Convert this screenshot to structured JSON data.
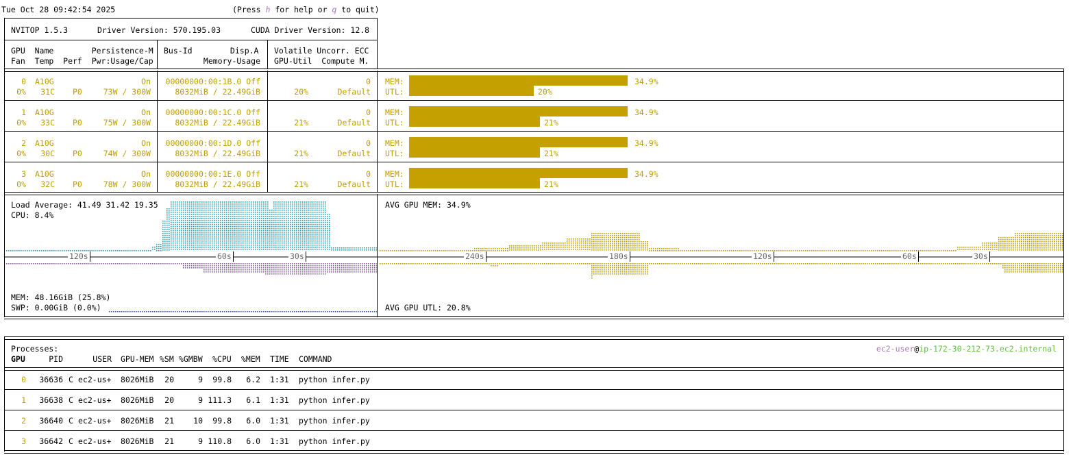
{
  "top": {
    "datetime": "Tue Oct 28 09:42:54 2025",
    "help_prefix": "(Press ",
    "help_key": "h",
    "help_mid": " for help or ",
    "quit_key": "q",
    "help_suffix": " to quit)"
  },
  "header": {
    "app": "NVITOP 1.5.3",
    "driver": "Driver Version: 570.195.03",
    "cuda": "CUDA Driver Version: 12.8",
    "col1_line1": "GPU  Name        Persistence-M",
    "col1_line2": "Fan  Temp  Perf  Pwr:Usage/Cap",
    "col2_line1": "Bus-Id        Disp.A",
    "col2_line2": "Memory-Usage",
    "col3_line1": "Volatile Uncorr. ECC",
    "col3_line2": "GPU-Util  Compute M."
  },
  "gpus": [
    {
      "idx": "0",
      "name": "A10G",
      "persist": "On",
      "fan": "0%",
      "temp": "31C",
      "perf": "P0",
      "pwr": "73W / 300W",
      "bus": "00000000:00:1B.0 Off",
      "mem": "8032MiB / 22.49GiB",
      "ecc": "0",
      "util": "20%",
      "compute": "Default",
      "mem_label": "MEM:",
      "mem_pct": "34.9%",
      "mem_frac": 0.349,
      "utl_label": "UTL:",
      "utl_pct": "20%",
      "utl_frac": 0.2
    },
    {
      "idx": "1",
      "name": "A10G",
      "persist": "On",
      "fan": "0%",
      "temp": "33C",
      "perf": "P0",
      "pwr": "75W / 300W",
      "bus": "00000000:00:1C.0 Off",
      "mem": "8032MiB / 22.49GiB",
      "ecc": "0",
      "util": "21%",
      "compute": "Default",
      "mem_label": "MEM:",
      "mem_pct": "34.9%",
      "mem_frac": 0.349,
      "utl_label": "UTL:",
      "utl_pct": "21%",
      "utl_frac": 0.21
    },
    {
      "idx": "2",
      "name": "A10G",
      "persist": "On",
      "fan": "0%",
      "temp": "30C",
      "perf": "P0",
      "pwr": "74W / 300W",
      "bus": "00000000:00:1D.0 Off",
      "mem": "8032MiB / 22.49GiB",
      "ecc": "0",
      "util": "21%",
      "compute": "Default",
      "mem_label": "MEM:",
      "mem_pct": "34.9%",
      "mem_frac": 0.349,
      "utl_label": "UTL:",
      "utl_pct": "21%",
      "utl_frac": 0.21
    },
    {
      "idx": "3",
      "name": "A10G",
      "persist": "On",
      "fan": "0%",
      "temp": "32C",
      "perf": "P0",
      "pwr": "78W / 300W",
      "bus": "00000000:00:1E.0 Off",
      "mem": "8032MiB / 22.49GiB",
      "ecc": "0",
      "util": "21%",
      "compute": "Default",
      "mem_label": "MEM:",
      "mem_pct": "34.9%",
      "mem_frac": 0.349,
      "utl_label": "UTL:",
      "utl_pct": "21%",
      "utl_frac": 0.21
    }
  ],
  "host_panel": {
    "load": "Load Average: 41.49 31.42 19.35",
    "cpu": "CPU: 8.4%",
    "mem": "MEM: 48.16GiB (25.8%)",
    "swp": "SWP: 0.00GiB (0.0%)",
    "ticks": [
      "120s",
      "60s",
      "30s"
    ]
  },
  "gpu_panel": {
    "avg_mem": "AVG GPU MEM: 34.9%",
    "avg_utl": "AVG GPU UTL: 20.8%",
    "ticks": [
      "240s",
      "180s",
      "120s",
      "60s",
      "30s"
    ]
  },
  "colors": {
    "gpu_yellow": "#bf9d00",
    "cpu_teal": "#26a0b5",
    "mem_purple": "#8e5fa3",
    "user_purple": "#a67ab1",
    "host_green": "#5fbf3a"
  },
  "processes": {
    "title": "Processes:",
    "user": "ec2-user",
    "at": "@",
    "host": "ip-172-30-212-73.ec2.internal",
    "columns": {
      "gpu": "GPU",
      "pid": "PID",
      "user": "USER",
      "gpumem": "GPU-MEM",
      "sm": "%SM",
      "gmbw": "%GMBW",
      "cpu": "%CPU",
      "mem": "%MEM",
      "time": "TIME",
      "cmd": "COMMAND"
    },
    "rows": [
      {
        "gpu": "0",
        "pid": "36636",
        "type": "C",
        "user": "ec2-us+",
        "gpumem": "8026MiB",
        "sm": "20",
        "gmbw": "9",
        "cpu": "99.8",
        "mem": "6.2",
        "time": "1:31",
        "cmd": "python infer.py"
      },
      {
        "gpu": "1",
        "pid": "36638",
        "type": "C",
        "user": "ec2-us+",
        "gpumem": "8026MiB",
        "sm": "20",
        "gmbw": "9",
        "cpu": "111.3",
        "mem": "6.1",
        "time": "1:31",
        "cmd": "python infer.py"
      },
      {
        "gpu": "2",
        "pid": "36640",
        "type": "C",
        "user": "ec2-us+",
        "gpumem": "8026MiB",
        "sm": "21",
        "gmbw": "10",
        "cpu": "99.8",
        "mem": "6.0",
        "time": "1:31",
        "cmd": "python infer.py"
      },
      {
        "gpu": "3",
        "pid": "36642",
        "type": "C",
        "user": "ec2-us+",
        "gpumem": "8026MiB",
        "sm": "21",
        "gmbw": "9",
        "cpu": "110.8",
        "mem": "6.0",
        "time": "1:31",
        "cmd": "python infer.py"
      }
    ]
  }
}
